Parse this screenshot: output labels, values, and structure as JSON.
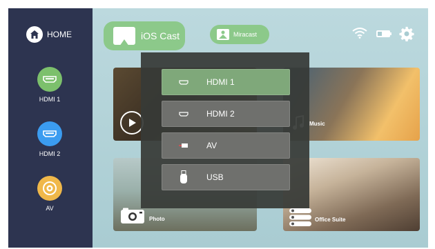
{
  "sidebar": {
    "home_label": "HOME",
    "items": [
      {
        "label": "HDMI 1",
        "color": "#7cc06c"
      },
      {
        "label": "HDMI 2",
        "color": "#3b9cf0"
      },
      {
        "label": "AV",
        "color": "#f0b84a"
      }
    ]
  },
  "header": {
    "ios_cast_label": "iOS Cast",
    "miracast_label": "Miracast",
    "icons": [
      "wifi-icon",
      "storage-icon",
      "gear-icon"
    ]
  },
  "tiles": {
    "music_label": "Music",
    "photo_label": "Photo",
    "office_label": "Office Suite"
  },
  "source_menu": {
    "options": [
      {
        "label": "HDMI 1",
        "icon": "hdmi-icon",
        "selected": true
      },
      {
        "label": "HDMI 2",
        "icon": "hdmi-icon",
        "selected": false
      },
      {
        "label": "AV",
        "icon": "av-icon",
        "selected": false
      },
      {
        "label": "USB",
        "icon": "usb-icon",
        "selected": false
      }
    ]
  },
  "colors": {
    "sidebar_bg": "#2d3450",
    "accent_green": "#8cc98a",
    "selected_option": "#7fa87a"
  }
}
